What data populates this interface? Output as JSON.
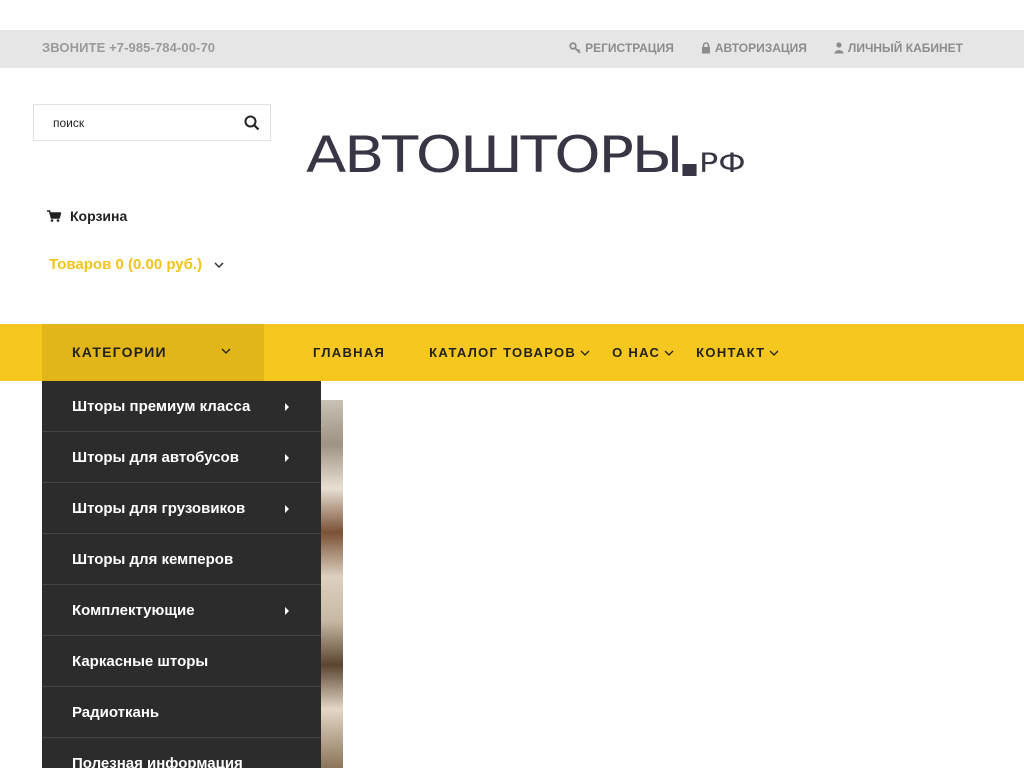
{
  "topbar": {
    "phone": "ЗВОНИТЕ +7-985-784-00-70",
    "links": [
      {
        "label": "РЕГИСТРАЦИЯ",
        "icon": "key-icon"
      },
      {
        "label": "АВТОРИЗАЦИЯ",
        "icon": "lock-icon"
      },
      {
        "label": "ЛИЧНЫЙ КАБИНЕТ",
        "icon": "user-icon"
      }
    ]
  },
  "search": {
    "placeholder": "поиск",
    "value": ""
  },
  "logo": {
    "main": "АВТОШТОРЫ",
    "suffix": "РФ"
  },
  "cart": {
    "label": "Корзина",
    "total": "Товаров 0 (0.00 руб.)"
  },
  "nav": {
    "categories_label": "КАТЕГОРИИ",
    "items": [
      {
        "label": "ГЛАВНАЯ",
        "has_dropdown": false
      },
      {
        "label": "КАТАЛОГ ТОВАРОВ",
        "has_dropdown": true
      },
      {
        "label": "О НАС",
        "has_dropdown": true
      },
      {
        "label": "КОНТАКТ",
        "has_dropdown": true
      }
    ]
  },
  "categories": [
    {
      "label": "Шторы премиум класса",
      "has_submenu": true
    },
    {
      "label": "Шторы для автобусов",
      "has_submenu": true
    },
    {
      "label": "Шторы для грузовиков",
      "has_submenu": true
    },
    {
      "label": "Шторы для кемперов",
      "has_submenu": false
    },
    {
      "label": "Комплектующие",
      "has_submenu": true
    },
    {
      "label": "Каркасные шторы",
      "has_submenu": false
    },
    {
      "label": "Радиоткань",
      "has_submenu": false
    },
    {
      "label": "Полезная информация",
      "has_submenu": false
    }
  ],
  "colors": {
    "accent": "#f5c71f",
    "accent_dark": "#e2b519",
    "menu_bg": "#2c2c2c",
    "cart_total": "#f2c318"
  }
}
